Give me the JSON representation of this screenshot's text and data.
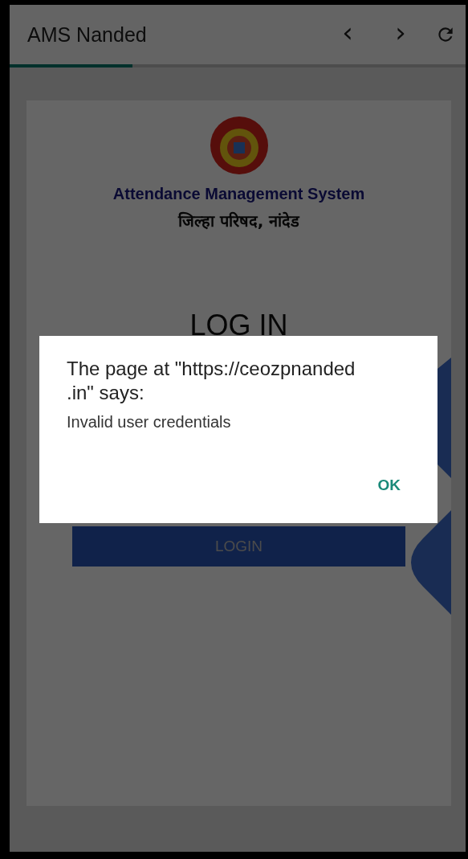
{
  "app_bar": {
    "title": "AMS Nanded",
    "back": "‹",
    "forward": "›"
  },
  "progress": {
    "level": 0.27
  },
  "card": {
    "title": "Attendance Management System",
    "subtitle": "जिल्हा परिषद, नांदेड",
    "heading": "LOG IN",
    "login_button": "LOGIN"
  },
  "dialog": {
    "title": "The page at \"https://ceozpnanded\n.in\" says:",
    "message": "Invalid user credentials",
    "ok_button": "OK"
  }
}
